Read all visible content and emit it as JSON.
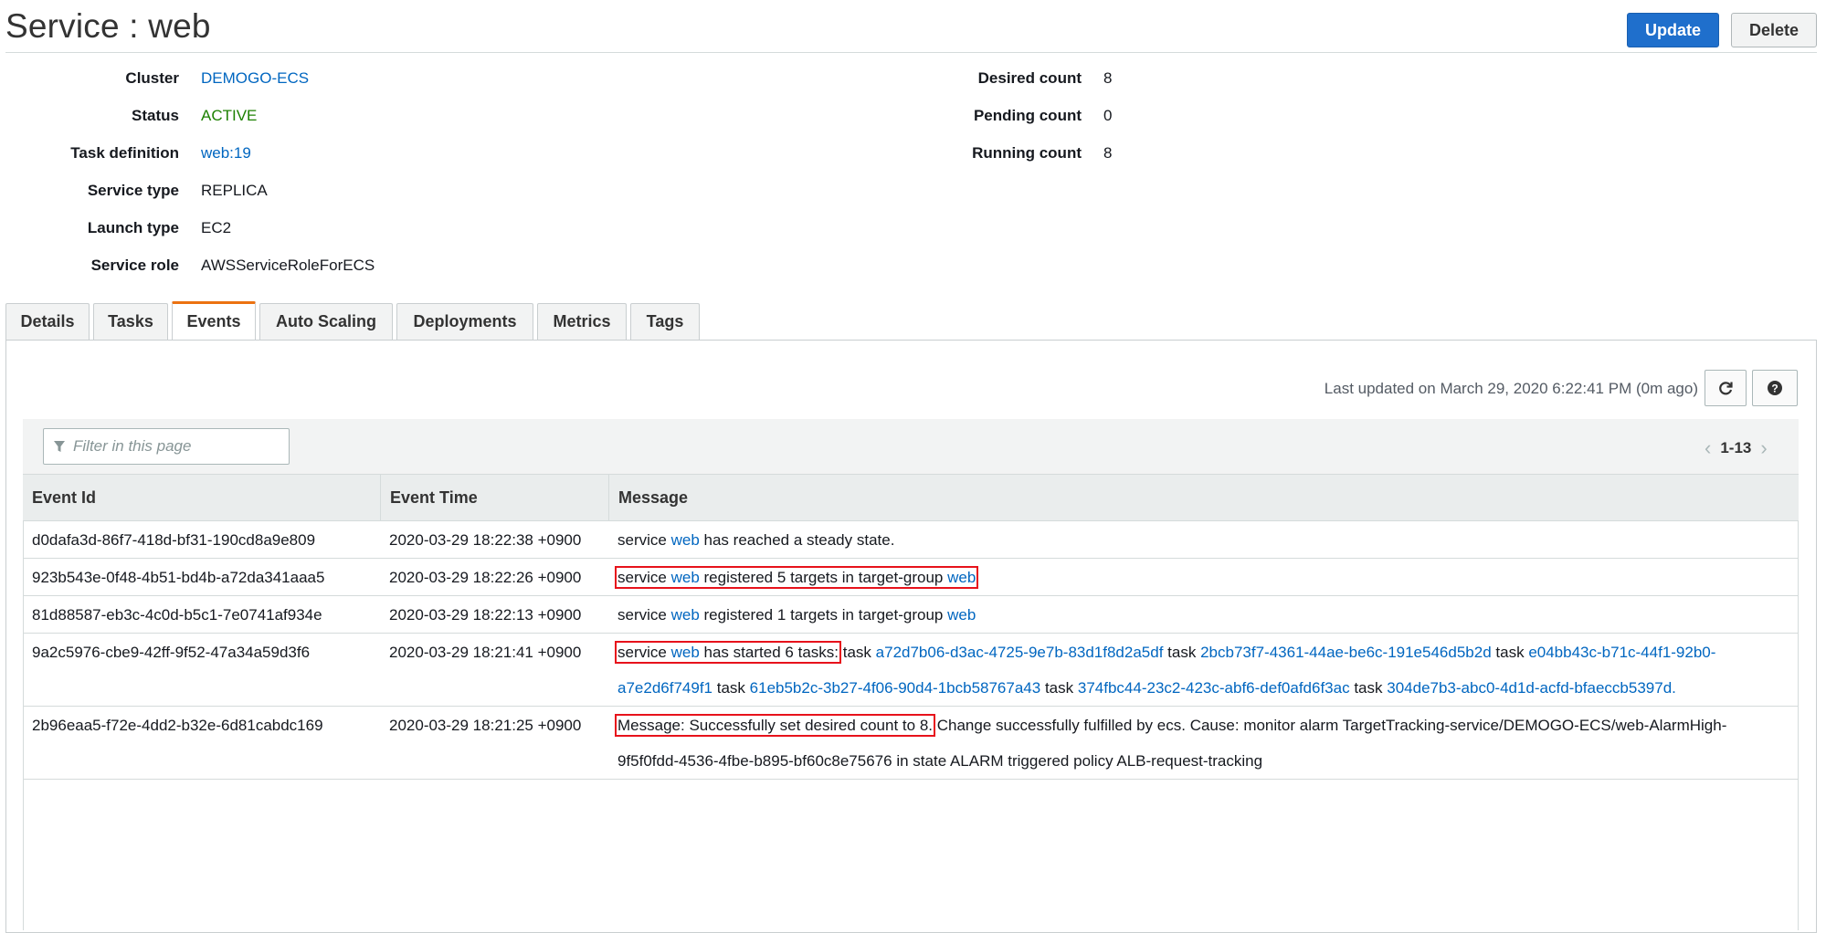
{
  "header": {
    "title": "Service : web",
    "update_label": "Update",
    "delete_label": "Delete"
  },
  "details_left": [
    {
      "key": "Cluster",
      "value": "DEMOGO-ECS"
    },
    {
      "key": "Status",
      "value": "ACTIVE"
    },
    {
      "key": "Task definition",
      "value": "web:19"
    },
    {
      "key": "Service type",
      "value": "REPLICA"
    },
    {
      "key": "Launch type",
      "value": "EC2"
    },
    {
      "key": "Service role",
      "value": "AWSServiceRoleForECS"
    }
  ],
  "details_right": [
    {
      "key": "Desired count",
      "value": "8"
    },
    {
      "key": "Pending count",
      "value": "0"
    },
    {
      "key": "Running count",
      "value": "8"
    }
  ],
  "tabs": [
    "Details",
    "Tasks",
    "Events",
    "Auto Scaling",
    "Deployments",
    "Metrics",
    "Tags"
  ],
  "active_tab": "Events",
  "toolbar": {
    "last_updated": "Last updated on March 29, 2020 6:22:41 PM (0m ago)",
    "filter_placeholder": "Filter in this page",
    "pager_range": "1-13",
    "prev_symbol": "‹",
    "next_symbol": "›"
  },
  "table": {
    "headers": [
      "Event Id",
      "Event Time",
      "Message"
    ],
    "rows": [
      {
        "id": "d0dafa3d-86f7-418d-bf31-190cd8a9e809",
        "time": "2020-03-29 18:22:38 +0900",
        "message": "service web has reached a steady state."
      },
      {
        "id": "923b543e-0f48-4b51-bd4b-a72da341aaa5",
        "time": "2020-03-29 18:22:26 +0900",
        "message": "service web registered 5 targets in target-group web"
      },
      {
        "id": "81d88587-eb3c-4c0d-b5c1-7e0741af934e",
        "time": "2020-03-29 18:22:13 +0900",
        "message": "service web registered 1 targets in target-group web"
      },
      {
        "id": "9a2c5976-cbe9-42ff-9f52-47a34a59d3f6",
        "time": "2020-03-29 18:21:41 +0900",
        "message": "service web has started 6 tasks: task a72d7b06-d3ac-4725-9e7b-83d1f8d2a5df task 2bcb73f7-4361-44ae-be6c-191e546d5b2d task e04bb43c-b71c-44f1-92b0-a7e2d6f749f1 task 61eb5b2c-3b27-4f06-90d4-1bcb58767a43 task 374fbc44-23c2-423c-abf6-def0afd6f3ac task 304de7b3-abc0-4d1d-acfd-bfaeccb5397d."
      },
      {
        "id": "2b96eaa5-f72e-4dd2-b32e-6d81cabdc169",
        "time": "2020-03-29 18:21:25 +0900",
        "message": "Message: Successfully set desired count to 8. Change successfully fulfilled by ecs. Cause: monitor alarm TargetTracking-service/DEMOGO-ECS/web-AlarmHigh-9f5f0fdd-4536-4fbe-b895-bf60c8e75676 in state ALARM triggered policy ALB-request-tracking"
      }
    ]
  },
  "colors": {
    "link": "#0066c0",
    "active_status": "#1d8102",
    "primary_button": "#1f6fcc",
    "tab_accent": "#ec7211",
    "highlight_box": "#e7121b"
  },
  "icons": {
    "refresh": "refresh-icon",
    "help": "help-icon",
    "filter": "filter-icon"
  }
}
